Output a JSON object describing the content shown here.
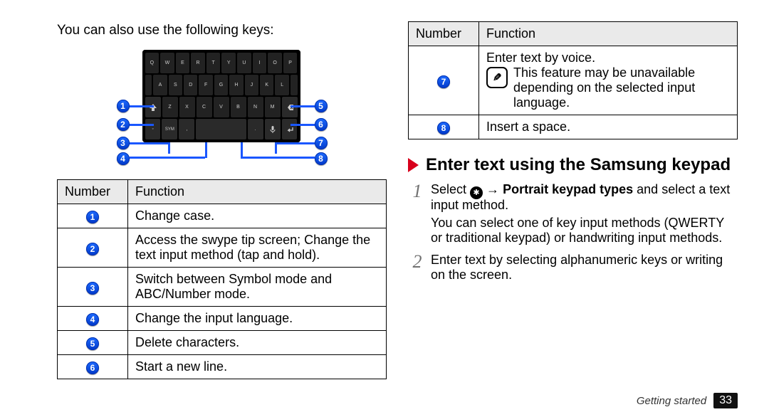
{
  "left": {
    "intro": "You can also use the following keys:",
    "table": {
      "h_num": "Number",
      "h_func": "Function",
      "rows": [
        {
          "n": "1",
          "f": "Change case."
        },
        {
          "n": "2",
          "f": "Access the swype tip screen; Change the text input method (tap and hold)."
        },
        {
          "n": "3",
          "f": "Switch between Symbol mode and ABC/Number mode."
        },
        {
          "n": "4",
          "f": "Change the input language."
        },
        {
          "n": "5",
          "f": "Delete characters."
        },
        {
          "n": "6",
          "f": "Start a new line."
        }
      ]
    }
  },
  "right": {
    "table": {
      "h_num": "Number",
      "h_func": "Function",
      "rows": [
        {
          "n": "7",
          "f1": "Enter text by voice.",
          "f2": "This feature may be unavailable depending on the selected input language."
        },
        {
          "n": "8",
          "f": "Insert a space."
        }
      ]
    },
    "section": {
      "title": "Enter text using the Samsung keypad",
      "step1_a": "Select ",
      "step1_b": " → ",
      "step1_bold": "Portrait keypad types",
      "step1_c": " and select a text input method.",
      "step1_note": "You can select one of key input methods (QWERTY or traditional keypad) or handwriting input methods.",
      "step2": "Enter text by selecting alphanumeric keys or writing on the screen."
    }
  },
  "footer": {
    "section": "Getting started",
    "page": "33"
  }
}
